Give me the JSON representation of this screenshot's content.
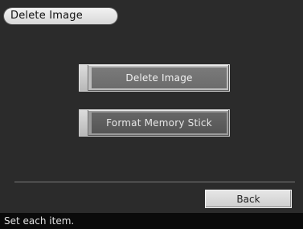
{
  "header": {
    "title": "Delete Image"
  },
  "menu": {
    "items": [
      {
        "label": "Delete Image",
        "selected": true
      },
      {
        "label": "Format Memory Stick",
        "selected": false
      }
    ]
  },
  "footer": {
    "back_label": "Back"
  },
  "status": {
    "text": "Set each item."
  }
}
